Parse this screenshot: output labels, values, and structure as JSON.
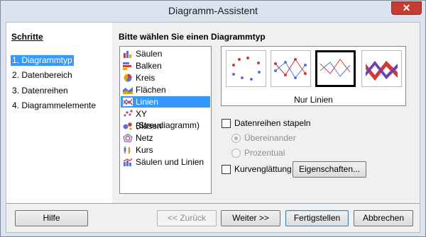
{
  "window": {
    "title": "Diagramm-Assistent",
    "close_glyph": "✕"
  },
  "steps": {
    "title": "Schritte",
    "items": [
      {
        "label": "1. Diagrammtyp",
        "active": true
      },
      {
        "label": "2. Datenbereich",
        "active": false
      },
      {
        "label": "3. Datenreihen",
        "active": false
      },
      {
        "label": "4. Diagrammelemente",
        "active": false
      }
    ]
  },
  "main": {
    "section_title": "Bitte wählen Sie einen Diagrammtyp",
    "chart_types": [
      {
        "label": "Säulen",
        "icon": "column-chart-icon"
      },
      {
        "label": "Balken",
        "icon": "bar-chart-icon"
      },
      {
        "label": "Kreis",
        "icon": "pie-chart-icon"
      },
      {
        "label": "Flächen",
        "icon": "area-chart-icon"
      },
      {
        "label": "Linien",
        "icon": "line-chart-icon",
        "selected": true
      },
      {
        "label": "XY (Streudiagramm)",
        "icon": "scatter-chart-icon"
      },
      {
        "label": "Blasen",
        "icon": "bubble-chart-icon"
      },
      {
        "label": "Netz",
        "icon": "net-chart-icon"
      },
      {
        "label": "Kurs",
        "icon": "stock-chart-icon"
      },
      {
        "label": "Säulen und Linien",
        "icon": "column-line-chart-icon"
      }
    ],
    "variants": {
      "caption": "Nur Linien",
      "items": [
        "points-only",
        "points-and-lines",
        "lines-only",
        "3d-lines"
      ],
      "selected_index": 2
    },
    "options": {
      "stack_series": {
        "label": "Datenreihen stapeln",
        "checked": false
      },
      "on_top": {
        "label": "Übereinander",
        "checked": true,
        "enabled": false
      },
      "percent": {
        "label": "Prozentual",
        "checked": false,
        "enabled": false
      },
      "smooth": {
        "label": "Kurvenglättung",
        "checked": false
      },
      "properties_button": "Eigenschaften..."
    }
  },
  "footer": {
    "help": "Hilfe",
    "back": "<< Zurück",
    "next": "Weiter >>",
    "finish": "Fertigstellen",
    "cancel": "Abbrechen"
  },
  "colors": {
    "selection": "#3399ff",
    "close": "#c43c33",
    "series_blue": "#5b73d8",
    "series_red": "#d23a3a"
  }
}
